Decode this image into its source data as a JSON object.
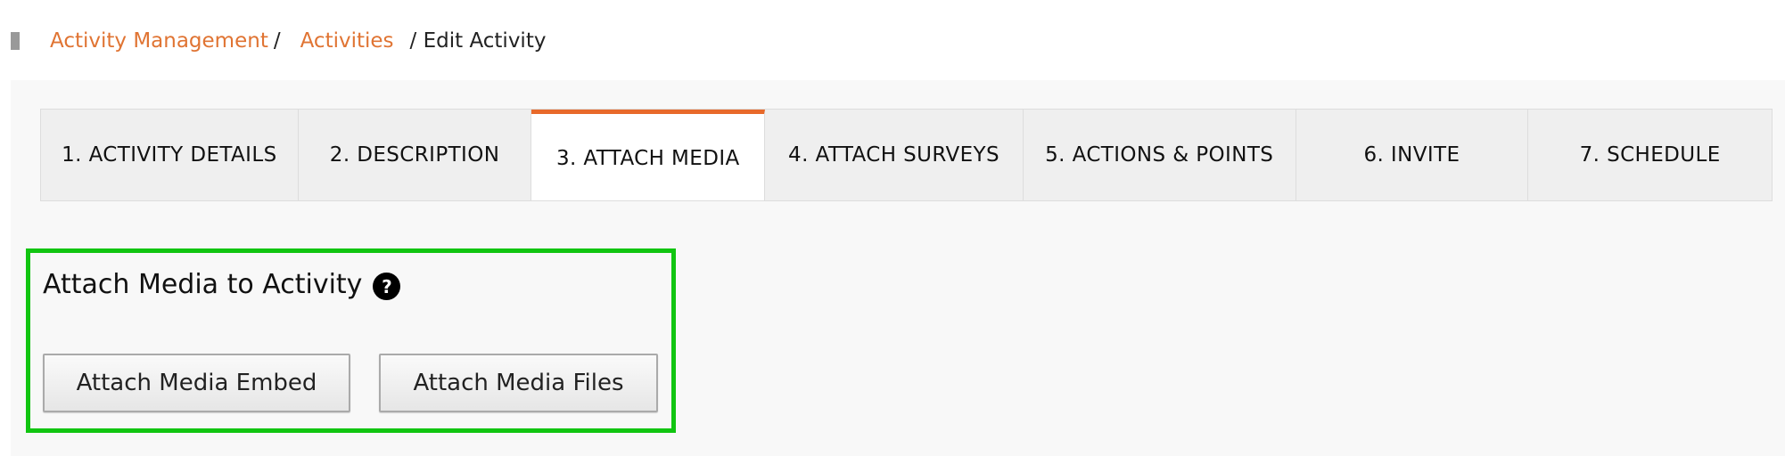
{
  "breadcrumb": {
    "items": [
      {
        "label": "Activity Management"
      },
      {
        "label": "Activities"
      }
    ],
    "separator": "/",
    "current": "/ Edit Activity"
  },
  "tabs": [
    {
      "label": "1. ACTIVITY DETAILS",
      "active": false
    },
    {
      "label": "2. DESCRIPTION",
      "active": false
    },
    {
      "label": "3. ATTACH MEDIA",
      "active": true
    },
    {
      "label": "4. ATTACH SURVEYS",
      "active": false
    },
    {
      "label": "5. ACTIONS & POINTS",
      "active": false
    },
    {
      "label": "6. INVITE",
      "active": false
    },
    {
      "label": "7. SCHEDULE",
      "active": false
    }
  ],
  "section": {
    "title": "Attach Media to Activity",
    "help_icon": "question-circle-icon",
    "help_glyph": "?",
    "buttons": {
      "embed_label": "Attach Media Embed",
      "files_label": "Attach Media Files"
    }
  },
  "colors": {
    "accent": "#e8692a",
    "link": "#e07433",
    "highlight_border": "#11c511"
  }
}
